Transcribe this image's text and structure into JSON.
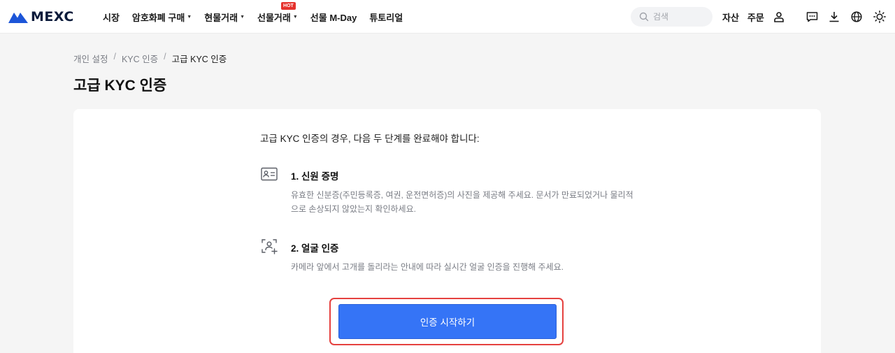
{
  "brand": {
    "name": "MEXC",
    "accent": "#3574f6",
    "logo_color": "#1c55d8"
  },
  "nav": {
    "items": [
      {
        "label": "시장",
        "dropdown": false
      },
      {
        "label": "암호화폐 구매",
        "dropdown": true
      },
      {
        "label": "현물거래",
        "dropdown": true
      },
      {
        "label": "선물거래",
        "dropdown": true,
        "badge": "HOT"
      },
      {
        "label": "선물 M-Day",
        "dropdown": false
      },
      {
        "label": "튜토리얼",
        "dropdown": false
      }
    ],
    "caret": "▼"
  },
  "search": {
    "placeholder": "검색",
    "icon": "search-icon"
  },
  "header_right": {
    "links": [
      "자산",
      "주문"
    ],
    "icons": [
      "user-icon",
      "message-icon",
      "download-icon",
      "globe-icon",
      "sun-icon"
    ]
  },
  "breadcrumb": {
    "items": [
      "개인 설정",
      "KYC 인증",
      "고급 KYC 인증"
    ],
    "separator": "/"
  },
  "page": {
    "title": "고급 KYC 인증"
  },
  "kyc": {
    "intro": "고급 KYC 인증의 경우, 다음 두 단계를 완료해야 합니다:",
    "steps": [
      {
        "icon": "id-card-icon",
        "title": "1. 신원 증명",
        "desc_line1": "유효한 신분증(주민등록증, 여권, 운전면허증)의 사진을 제공해 주세요. 문서가 만료되었거나 물리적",
        "desc_line2": "으로 손상되지 않았는지 확인하세요."
      },
      {
        "icon": "face-scan-icon",
        "title": "2. 얼굴 인증",
        "desc_line1": "카메라 앞에서 고개를 돌리라는 안내에 따라 실시간 얼굴 인증을 진행해 주세요."
      }
    ],
    "button_label": "인증 시작하기",
    "highlight_color": "#e5413f"
  }
}
